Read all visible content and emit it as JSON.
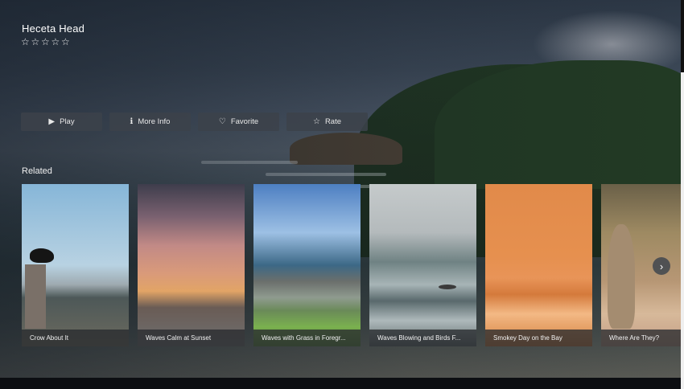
{
  "hero": {
    "title": "Heceta Head",
    "rating_stars": [
      "☆",
      "☆",
      "☆",
      "☆",
      "☆"
    ]
  },
  "actions": [
    {
      "label": "Play",
      "icon": "▶"
    },
    {
      "label": "More Info",
      "icon": "ℹ"
    },
    {
      "label": "Favorite",
      "icon": "♡"
    },
    {
      "label": "Rate",
      "icon": "☆"
    }
  ],
  "related": {
    "heading": "Related",
    "items": [
      {
        "title": "Crow About It"
      },
      {
        "title": "Waves Calm at Sunset"
      },
      {
        "title": "Waves with Grass in Foregr..."
      },
      {
        "title": "Waves Blowing and Birds F..."
      },
      {
        "title": "Smokey Day on the Bay"
      },
      {
        "title": "Where Are They?"
      }
    ],
    "next_icon": "›"
  }
}
